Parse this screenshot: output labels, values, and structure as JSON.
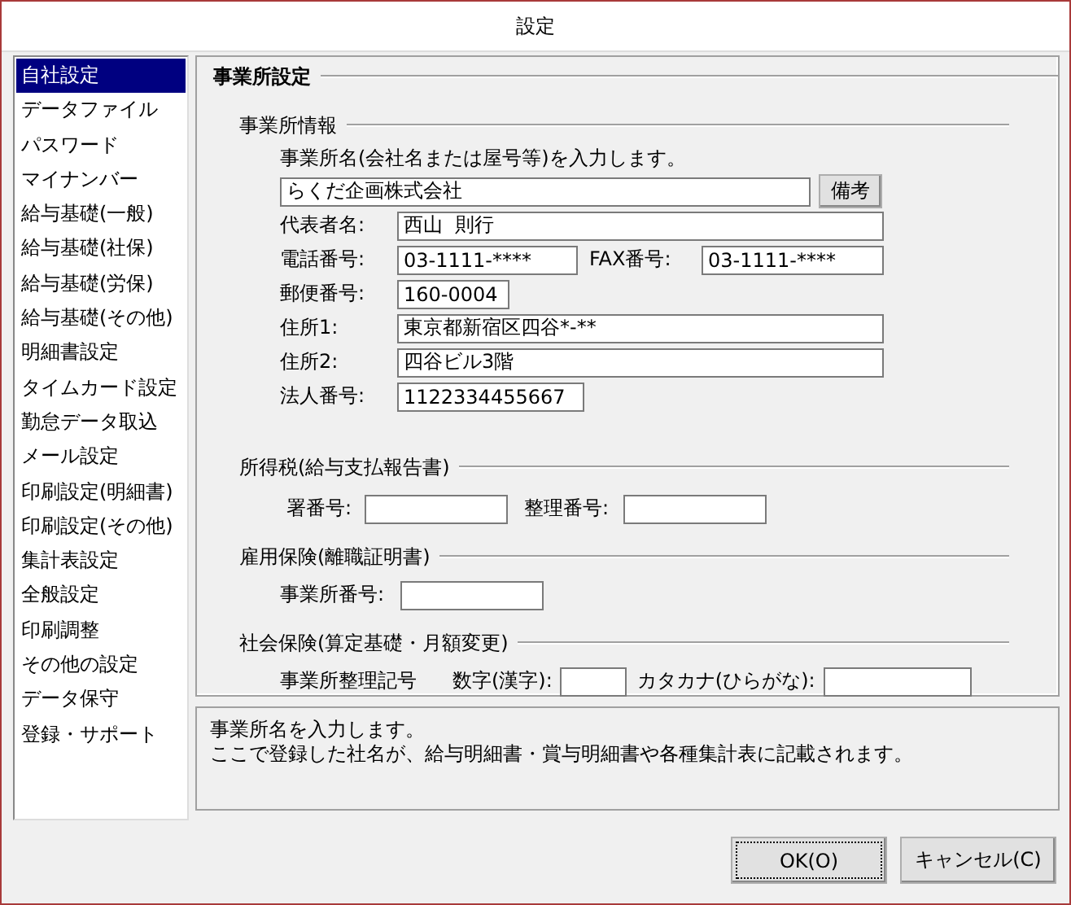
{
  "window": {
    "title": "設定"
  },
  "sidebar": {
    "items": [
      {
        "label": "自社設定",
        "selected": true
      },
      {
        "label": "データファイル",
        "selected": false
      },
      {
        "label": "パスワード",
        "selected": false
      },
      {
        "label": "マイナンバー",
        "selected": false
      },
      {
        "label": "給与基礎(一般)",
        "selected": false
      },
      {
        "label": "給与基礎(社保)",
        "selected": false
      },
      {
        "label": "給与基礎(労保)",
        "selected": false
      },
      {
        "label": "給与基礎(その他)",
        "selected": false
      },
      {
        "label": "明細書設定",
        "selected": false
      },
      {
        "label": "タイムカード設定",
        "selected": false
      },
      {
        "label": "勤怠データ取込",
        "selected": false
      },
      {
        "label": "メール設定",
        "selected": false
      },
      {
        "label": "印刷設定(明細書)",
        "selected": false
      },
      {
        "label": "印刷設定(その他)",
        "selected": false
      },
      {
        "label": "集計表設定",
        "selected": false
      },
      {
        "label": "全般設定",
        "selected": false
      },
      {
        "label": "印刷調整",
        "selected": false
      },
      {
        "label": "その他の設定",
        "selected": false
      },
      {
        "label": "データ保守",
        "selected": false
      },
      {
        "label": "登録・サポート",
        "selected": false
      }
    ]
  },
  "panel": {
    "title": "事業所設定",
    "office_info": {
      "title": "事業所情報",
      "name_prompt": "事業所名(会社名または屋号等)を入力します。",
      "name_value": "らくだ企画株式会社",
      "note_button": "備考",
      "rows": [
        [
          {
            "label": "代表者名:",
            "value": "西山  則行"
          }
        ],
        [
          {
            "label": "電話番号:",
            "value": "03-1111-****"
          },
          {
            "label": "FAX番号:",
            "value": "03-1111-****"
          }
        ],
        [
          {
            "label": "郵便番号:",
            "value": "160-0004"
          }
        ],
        [
          {
            "label": "住所1:",
            "value": "東京都新宿区四谷*-**"
          }
        ],
        [
          {
            "label": "住所2:",
            "value": "四谷ビル3階"
          }
        ],
        [
          {
            "label": "法人番号:",
            "value": "1122334455667"
          }
        ]
      ]
    },
    "income_tax": {
      "title": "所得税(給与支払報告書)",
      "fields": [
        {
          "label": "署番号:"
        },
        {
          "label": "整理番号:"
        }
      ]
    },
    "employment_insurance": {
      "title": "雇用保険(離職証明書)",
      "fields": [
        {
          "label": "事業所番号:"
        }
      ]
    },
    "social_insurance": {
      "title": "社会保険(算定基礎・月額変更)",
      "caption": "事業所整理記号",
      "fields": [
        {
          "label": "数字(漢字):"
        },
        {
          "label": "カタカナ(ひらがな):"
        }
      ]
    }
  },
  "help": {
    "lines": [
      "事業所名を入力します。",
      "ここで登録した社名が、給与明細書・賞与明細書や各種集計表に記載されます。"
    ]
  },
  "buttons": [
    {
      "label": "OK(O)",
      "focused": true
    },
    {
      "label": "キャンセル(C)",
      "focused": false
    }
  ]
}
